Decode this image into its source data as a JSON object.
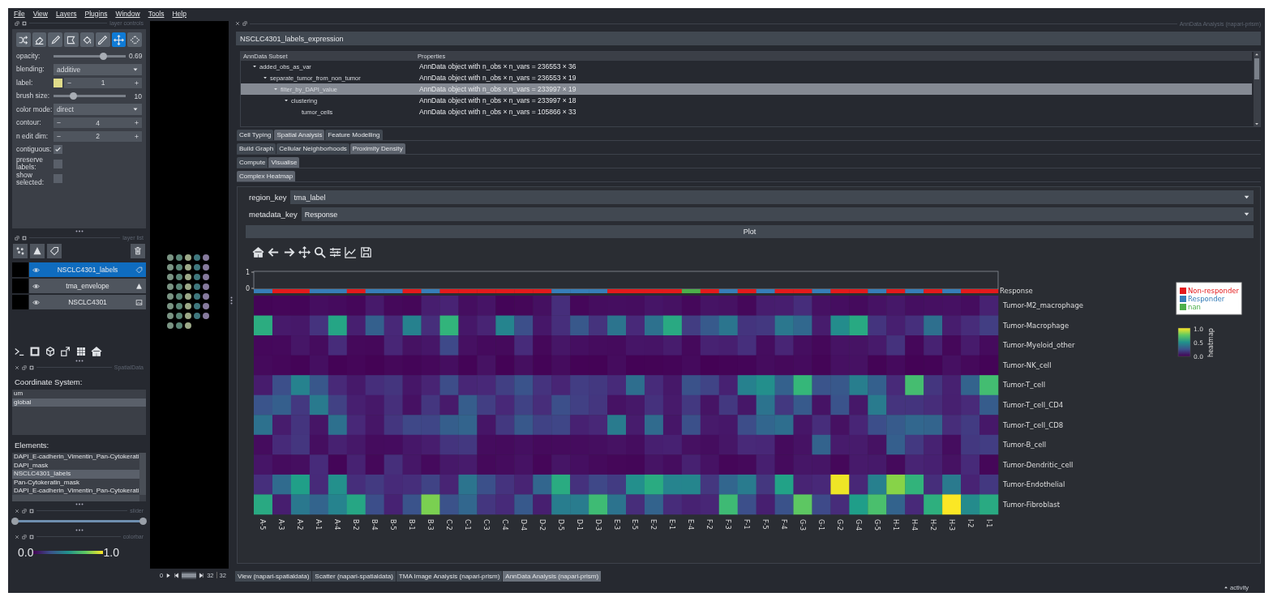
{
  "menu": [
    "File",
    "View",
    "Layers",
    "Plugins",
    "Window",
    "Tools",
    "Help"
  ],
  "layer_controls": {
    "title": "layer controls",
    "tools": [
      {
        "kind": "shuffle",
        "selected": false
      },
      {
        "kind": "eraser",
        "selected": false
      },
      {
        "kind": "brush",
        "selected": false
      },
      {
        "kind": "polygon",
        "selected": false
      },
      {
        "kind": "fill",
        "selected": false
      },
      {
        "kind": "picker",
        "selected": false
      },
      {
        "kind": "move",
        "selected": true
      },
      {
        "kind": "transform",
        "selected": false
      }
    ],
    "rows": [
      {
        "kind": "slider",
        "label": "opacity:",
        "level": 0.69,
        "reading": "0.69"
      },
      {
        "kind": "dropdown",
        "label": "blending:",
        "value": "additive"
      },
      {
        "kind": "swatch-spinner",
        "label": "label:",
        "value": "1"
      },
      {
        "kind": "slider",
        "label": "brush size:",
        "level": 0.27,
        "reading": "10"
      },
      {
        "kind": "dropdown",
        "label": "color mode:",
        "value": "direct"
      },
      {
        "kind": "spinner",
        "label": "contour:",
        "value": "4"
      },
      {
        "kind": "spinner",
        "label": "n edit dim:",
        "value": "2"
      },
      {
        "kind": "checkbox",
        "label": "contiguous:",
        "checked": true
      },
      {
        "kind": "checkbox",
        "label": "preserve labels:",
        "checked": false
      },
      {
        "kind": "checkbox",
        "label": "show selected:",
        "checked": false
      }
    ]
  },
  "layer_list": {
    "title": "layer list",
    "layers": [
      {
        "name": "NSCLC4301_labels",
        "kind": "labels",
        "selected": true,
        "visible": true
      },
      {
        "name": "tma_envelope",
        "kind": "shapes",
        "selected": false,
        "visible": true
      },
      {
        "name": "NSCLC4301",
        "kind": "image",
        "selected": false,
        "visible": true
      }
    ]
  },
  "spatialdata": {
    "title": "SpatialData",
    "coordinate_label": "Coordinate System:",
    "coordinate_systems": [
      {
        "name": "um",
        "selected": false
      },
      {
        "name": "global",
        "selected": true
      }
    ],
    "elements_label": "Elements:",
    "elements": [
      {
        "name": "DAPI_E-cadherin_Vimentin_Pan-Cytokerati",
        "selected": false
      },
      {
        "name": "DAPI_mask",
        "selected": false
      },
      {
        "name": "NSCLC4301_labels",
        "selected": true
      },
      {
        "name": "Pan-Cytokeratin_mask",
        "selected": false
      },
      {
        "name": "DAPI_E-cadherin_Vimentin_Pan-Cytokerati",
        "selected": false
      }
    ]
  },
  "slider": {
    "title": "slider",
    "level": 1
  },
  "colorbar": {
    "title": "colorbar",
    "min": "0.0",
    "max": "1.0"
  },
  "dims": {
    "frame": "0",
    "current": "32",
    "total": "32",
    "level": 1
  },
  "analysis": {
    "title": "AnnData Analysis (napari-prism)",
    "dataset": "NSCLC4301_labels_expression",
    "tree": {
      "columns": [
        "AnnData Subset",
        "Properties"
      ],
      "rows": [
        {
          "name": "added_obs_as_var",
          "properties": "AnnData object with n_obs × n_vars = 236553 × 36",
          "selected": false,
          "children": [
            {
              "name": "separate_tumor_from_non_tumor",
              "properties": "AnnData object with n_obs × n_vars = 236553 × 19",
              "selected": false,
              "children": [
                {
                  "name": "filter_by_DAPI_value",
                  "properties": "AnnData object with n_obs × n_vars = 233997 × 19",
                  "selected": true,
                  "children": [
                    {
                      "name": "clustering",
                      "properties": "AnnData object with n_obs × n_vars = 233997 × 18",
                      "selected": false,
                      "children": [
                        {
                          "name": "tumor_cells",
                          "properties": "AnnData object with n_obs × n_vars = 105866 × 33",
                          "selected": false
                        }
                      ]
                    }
                  ]
                }
              ]
            }
          ]
        }
      ]
    },
    "tab_rows": [
      {
        "tabs": [
          {
            "label": "Cell Typing",
            "selected": false
          },
          {
            "label": "Spatial Analysis",
            "selected": true
          },
          {
            "label": "Feature Modelling",
            "selected": false
          }
        ]
      },
      {
        "tabs": [
          {
            "label": "Build Graph",
            "selected": false
          },
          {
            "label": "Cellular Neighborhoods",
            "selected": false
          },
          {
            "label": "Proximity Density",
            "selected": true
          }
        ]
      },
      {
        "tabs": [
          {
            "label": "Compute",
            "selected": false
          },
          {
            "label": "Visualise",
            "selected": true
          }
        ]
      },
      {
        "tabs": [
          {
            "label": "Complex Heatmap",
            "selected": true
          }
        ]
      }
    ],
    "form": [
      {
        "label": "region_key",
        "value": "tma_label"
      },
      {
        "label": "metadata_key",
        "value": "Response"
      }
    ],
    "plot_button": "Plot",
    "heatmap": {
      "bar_ticks": [
        "1",
        "0"
      ],
      "annotation_label": "Response",
      "columns": [
        {
          "label": "A-5",
          "color": "#377eb8"
        },
        {
          "label": "A-3",
          "color": "#e41a1c"
        },
        {
          "label": "A-2",
          "color": "#e41a1c"
        },
        {
          "label": "A-1",
          "color": "#377eb8"
        },
        {
          "label": "A-4",
          "color": "#377eb8"
        },
        {
          "label": "B-2",
          "color": "#e41a1c"
        },
        {
          "label": "B-4",
          "color": "#377eb8"
        },
        {
          "label": "B-5",
          "color": "#377eb8"
        },
        {
          "label": "B-1",
          "color": "#e41a1c"
        },
        {
          "label": "B-3",
          "color": "#377eb8"
        },
        {
          "label": "C-2",
          "color": "#e41a1c"
        },
        {
          "label": "C-1",
          "color": "#e41a1c"
        },
        {
          "label": "C-3",
          "color": "#e41a1c"
        },
        {
          "label": "C-4",
          "color": "#e41a1c"
        },
        {
          "label": "D-4",
          "color": "#e41a1c"
        },
        {
          "label": "D-2",
          "color": "#e41a1c"
        },
        {
          "label": "D-5",
          "color": "#377eb8"
        },
        {
          "label": "D-1",
          "color": "#377eb8"
        },
        {
          "label": "D-3",
          "color": "#377eb8"
        },
        {
          "label": "E-3",
          "color": "#e41a1c"
        },
        {
          "label": "E-5",
          "color": "#e41a1c"
        },
        {
          "label": "E-2",
          "color": "#e41a1c"
        },
        {
          "label": "E-1",
          "color": "#e41a1c"
        },
        {
          "label": "E-4",
          "color": "#4daf4a"
        },
        {
          "label": "F-2",
          "color": "#e41a1c"
        },
        {
          "label": "F-3",
          "color": "#377eb8"
        },
        {
          "label": "F-1",
          "color": "#e41a1c"
        },
        {
          "label": "F-5",
          "color": "#377eb8"
        },
        {
          "label": "F-4",
          "color": "#e41a1c"
        },
        {
          "label": "G-3",
          "color": "#e41a1c"
        },
        {
          "label": "G-1",
          "color": "#377eb8"
        },
        {
          "label": "G-2",
          "color": "#e41a1c"
        },
        {
          "label": "G-4",
          "color": "#e41a1c"
        },
        {
          "label": "G-5",
          "color": "#377eb8"
        },
        {
          "label": "H-1",
          "color": "#e41a1c"
        },
        {
          "label": "H-4",
          "color": "#377eb8"
        },
        {
          "label": "H-2",
          "color": "#e41a1c"
        },
        {
          "label": "H-3",
          "color": "#377eb8"
        },
        {
          "label": "I-2",
          "color": "#e41a1c"
        },
        {
          "label": "I-1",
          "color": "#e41a1c"
        }
      ],
      "rows": [
        "Tumor-M2_macrophage",
        "Tumor-Macrophage",
        "Tumor-Myeloid_other",
        "Tumor-NK_cell",
        "Tumor-T_cell",
        "Tumor-T_cell_CD4",
        "Tumor-T_cell_CD8",
        "Tumor-B_cell",
        "Tumor-Dendritic_cell",
        "Tumor-Endothelial",
        "Tumor-Fibroblast"
      ],
      "legend": [
        {
          "label": "Non-responder",
          "color": "#e41a1c"
        },
        {
          "label": "Responder",
          "color": "#377eb8"
        },
        {
          "label": "nan",
          "color": "#4daf4a"
        }
      ],
      "colorbar": {
        "ticks": [
          "1.0",
          "0.5",
          "0.0"
        ],
        "label": "heatmap"
      }
    },
    "bottom_tabs": [
      {
        "label": "View (napari-spatialdata)",
        "selected": false
      },
      {
        "label": "Scatter (napari-spatialdata)",
        "selected": false
      },
      {
        "label": "TMA Image Analysis (napari-prism)",
        "selected": false
      },
      {
        "label": "AnnData Analysis (napari-prism)",
        "selected": true
      }
    ]
  },
  "status": "activity"
}
